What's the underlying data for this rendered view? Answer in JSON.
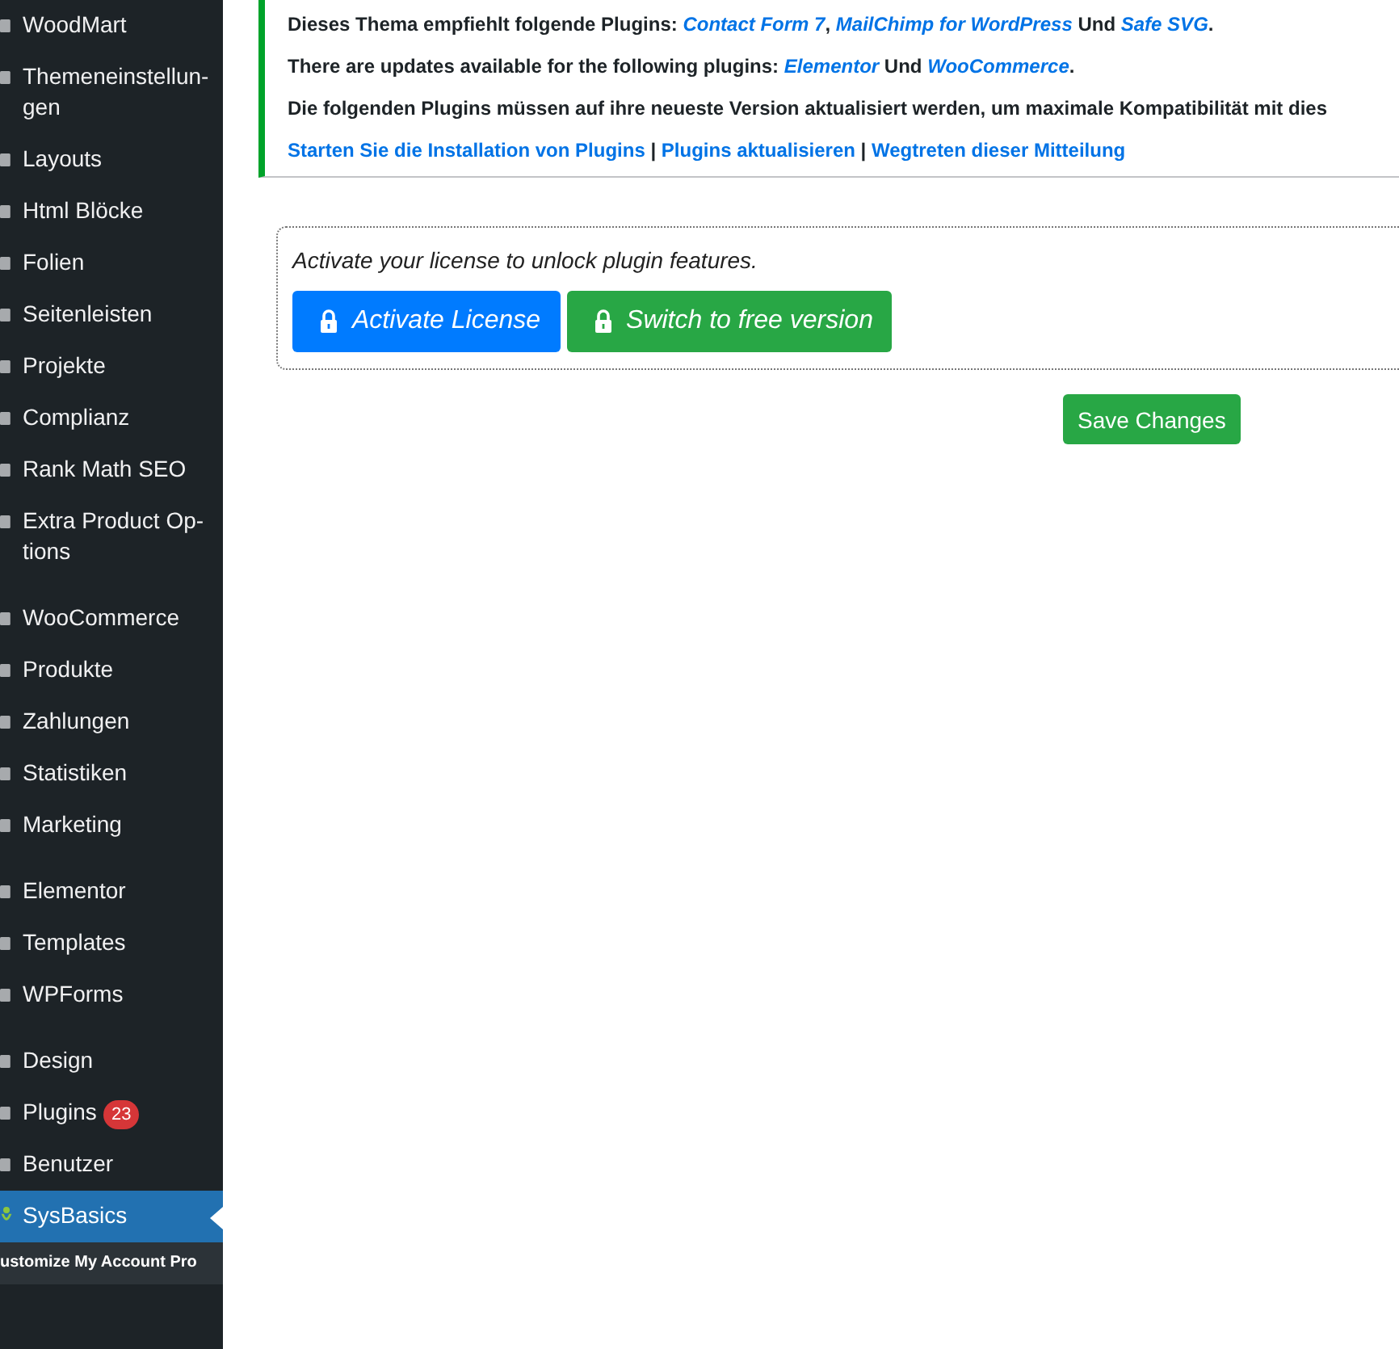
{
  "sidebar": {
    "groups": [
      {
        "items": [
          {
            "label": "WoodMart",
            "selected": false
          },
          {
            "label": "Themeneinstellun-gen",
            "selected": false
          },
          {
            "label": "Layouts",
            "selected": false
          },
          {
            "label": "Html Blöcke",
            "selected": false
          },
          {
            "label": "Folien",
            "selected": false
          },
          {
            "label": "Seitenleisten",
            "selected": false
          },
          {
            "label": "Projekte",
            "selected": false
          },
          {
            "label": "Complianz",
            "selected": false
          },
          {
            "label": "Rank Math SEO",
            "selected": false
          },
          {
            "label": "Extra Product Op-tions",
            "selected": false
          }
        ]
      },
      {
        "items": [
          {
            "label": "WooCommerce",
            "selected": false
          },
          {
            "label": "Produkte",
            "selected": false
          },
          {
            "label": "Zahlungen",
            "selected": false
          },
          {
            "label": "Statistiken",
            "selected": false
          },
          {
            "label": "Marketing",
            "selected": false
          }
        ]
      },
      {
        "items": [
          {
            "label": "Elementor",
            "selected": false
          },
          {
            "label": "Templates",
            "selected": false
          },
          {
            "label": "WPForms",
            "selected": false
          }
        ]
      },
      {
        "items": [
          {
            "label": "Design",
            "selected": false
          },
          {
            "label": "Plugins",
            "selected": false,
            "badge": "23"
          },
          {
            "label": "Benutzer",
            "selected": false
          },
          {
            "label": "SysBasics",
            "selected": true,
            "submenu": [
              {
                "label": "ustomize My Account Pro"
              }
            ]
          }
        ]
      }
    ]
  },
  "notice": {
    "lines": [
      [
        {
          "kind": "text",
          "text": "Dieses Thema empfiehlt folgende Plugins: "
        },
        {
          "kind": "plugin-link",
          "text": "Contact Form 7"
        },
        {
          "kind": "text",
          "text": ", "
        },
        {
          "kind": "plugin-link",
          "text": "MailChimp for WordPress"
        },
        {
          "kind": "text",
          "text": " Und "
        },
        {
          "kind": "plugin-link",
          "text": "Safe SVG"
        },
        {
          "kind": "text",
          "text": "."
        }
      ],
      [
        {
          "kind": "text",
          "text": "There are updates available for the following plugins: "
        },
        {
          "kind": "plugin-link",
          "text": "Elementor"
        },
        {
          "kind": "text",
          "text": " Und "
        },
        {
          "kind": "plugin-link",
          "text": "WooCommerce"
        },
        {
          "kind": "text",
          "text": "."
        }
      ],
      [
        {
          "kind": "text",
          "text": "Die folgenden Plugins müssen auf ihre neueste Version aktualisiert werden, um maximale Kompatibilität mit dies"
        }
      ],
      [
        {
          "kind": "action-link",
          "text": "Starten Sie die Installation von Plugins"
        },
        {
          "kind": "text",
          "text": " | "
        },
        {
          "kind": "action-link",
          "text": "Plugins aktualisieren"
        },
        {
          "kind": "text",
          "text": " | "
        },
        {
          "kind": "action-link",
          "text": "Wegtreten dieser Mitteilung"
        }
      ]
    ]
  },
  "license": {
    "message": "Activate your license to unlock plugin features.",
    "buttons": [
      {
        "label": "Activate License",
        "kind": "primary"
      },
      {
        "label": "Switch to free version",
        "kind": "success"
      }
    ]
  },
  "save_button": "Save Changes"
}
